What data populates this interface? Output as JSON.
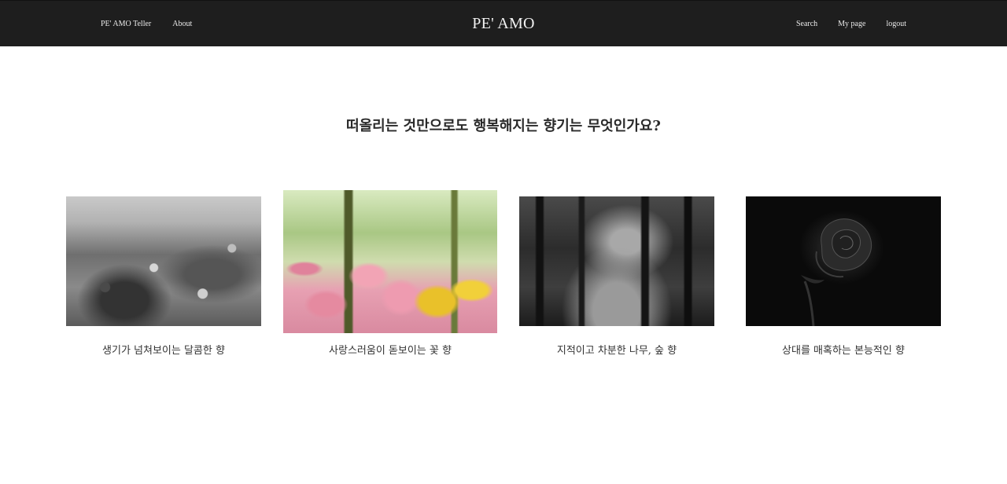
{
  "header": {
    "brand": "PE' AMO",
    "left_links": [
      "PE' AMO Teller",
      "About"
    ],
    "right_links": [
      "Search",
      "My page",
      "logout"
    ]
  },
  "main": {
    "question": "떠올리는 것만으로도 행복해지는 향기는 무엇인가요?",
    "cards": [
      {
        "caption": "생기가 넘쳐보이는 달콤한 향",
        "image": "orange-tree-photo"
      },
      {
        "caption": "사랑스러움이 돋보이는 꽃 향",
        "image": "tulips-photo"
      },
      {
        "caption": "지적이고 차분한 나무, 숲 향",
        "image": "forest-path-photo"
      },
      {
        "caption": "상대를 매혹하는 본능적인 향",
        "image": "black-rose-photo"
      }
    ]
  },
  "colors": {
    "header_bg": "#1e1e1e",
    "header_text": "#eaeaea",
    "page_bg": "#ffffff",
    "text": "#2a2a2a"
  }
}
